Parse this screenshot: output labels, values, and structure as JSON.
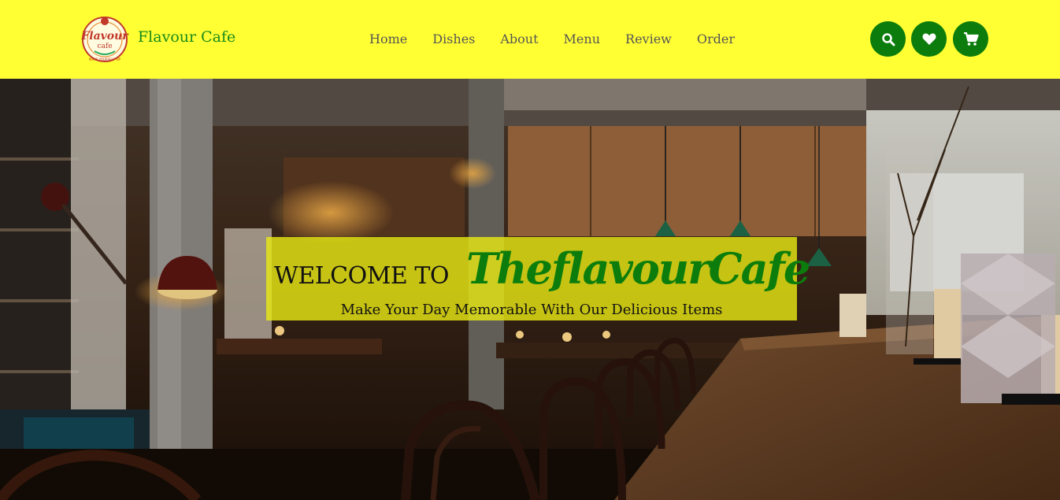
{
  "brand": {
    "name": "Flavour Cafe",
    "logo_text_main": "Flavour",
    "logo_text_sub": "cafe",
    "logo_text_arc": "MAKE YOURSELF UP"
  },
  "nav": {
    "items": [
      {
        "label": "Home"
      },
      {
        "label": "Dishes"
      },
      {
        "label": "About"
      },
      {
        "label": "Menu"
      },
      {
        "label": "Review"
      },
      {
        "label": "Order"
      }
    ]
  },
  "icons": {
    "search": "search-icon",
    "favorites": "heart-icon",
    "cart": "cart-icon"
  },
  "hero": {
    "welcome": "WELCOME TO",
    "cafe_name": "TheflavourCafe",
    "tagline": "Make Your Day Memorable With Our Delicious Items"
  },
  "colors": {
    "header_bg": "#ffff33",
    "brand_green": "#0c7d0c",
    "banner_bg": "#e6e614"
  }
}
